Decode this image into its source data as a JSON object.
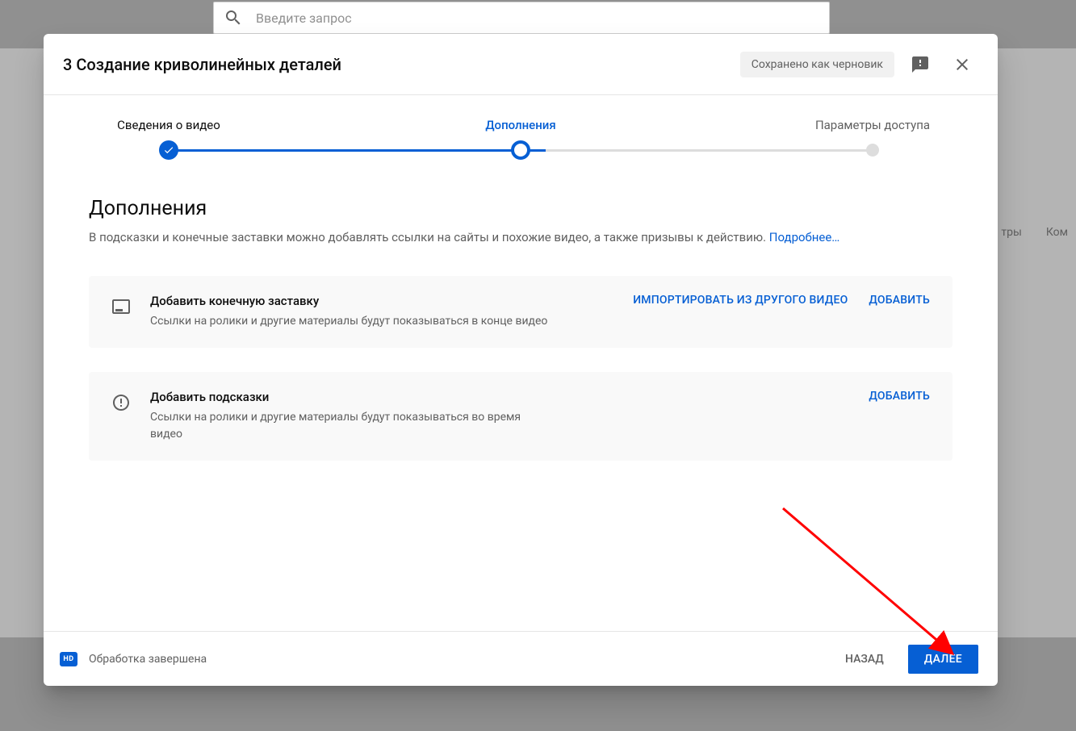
{
  "background": {
    "search_placeholder": "Введите запрос",
    "tab_filters": "тры",
    "tab_comments": "Ком"
  },
  "modal": {
    "title": "3 Создание криволинейных деталей",
    "status_chip": "Сохранено как черновик"
  },
  "stepper": {
    "step1": "Сведения о видео",
    "step2": "Дополнения",
    "step3": "Параметры доступа"
  },
  "content": {
    "heading": "Дополнения",
    "subtext": "В подсказки и конечные заставки можно добавлять ссылки на сайты и похожие видео, а также призывы к действию. ",
    "more_link": "Подробнее…"
  },
  "card_endscreen": {
    "title": "Добавить конечную заставку",
    "desc": "Ссылки на ролики и другие материалы будут показываться в конце видео",
    "import_btn": "ИМПОРТИРОВАТЬ ИЗ ДРУГОГО ВИДЕО",
    "add_btn": "ДОБАВИТЬ"
  },
  "card_cards": {
    "title": "Добавить подсказки",
    "desc": "Ссылки на ролики и другие материалы будут показываться во время видео",
    "add_btn": "ДОБАВИТЬ"
  },
  "footer": {
    "hd": "HD",
    "status": "Обработка завершена",
    "back": "НАЗАД",
    "next": "ДАЛЕЕ"
  }
}
